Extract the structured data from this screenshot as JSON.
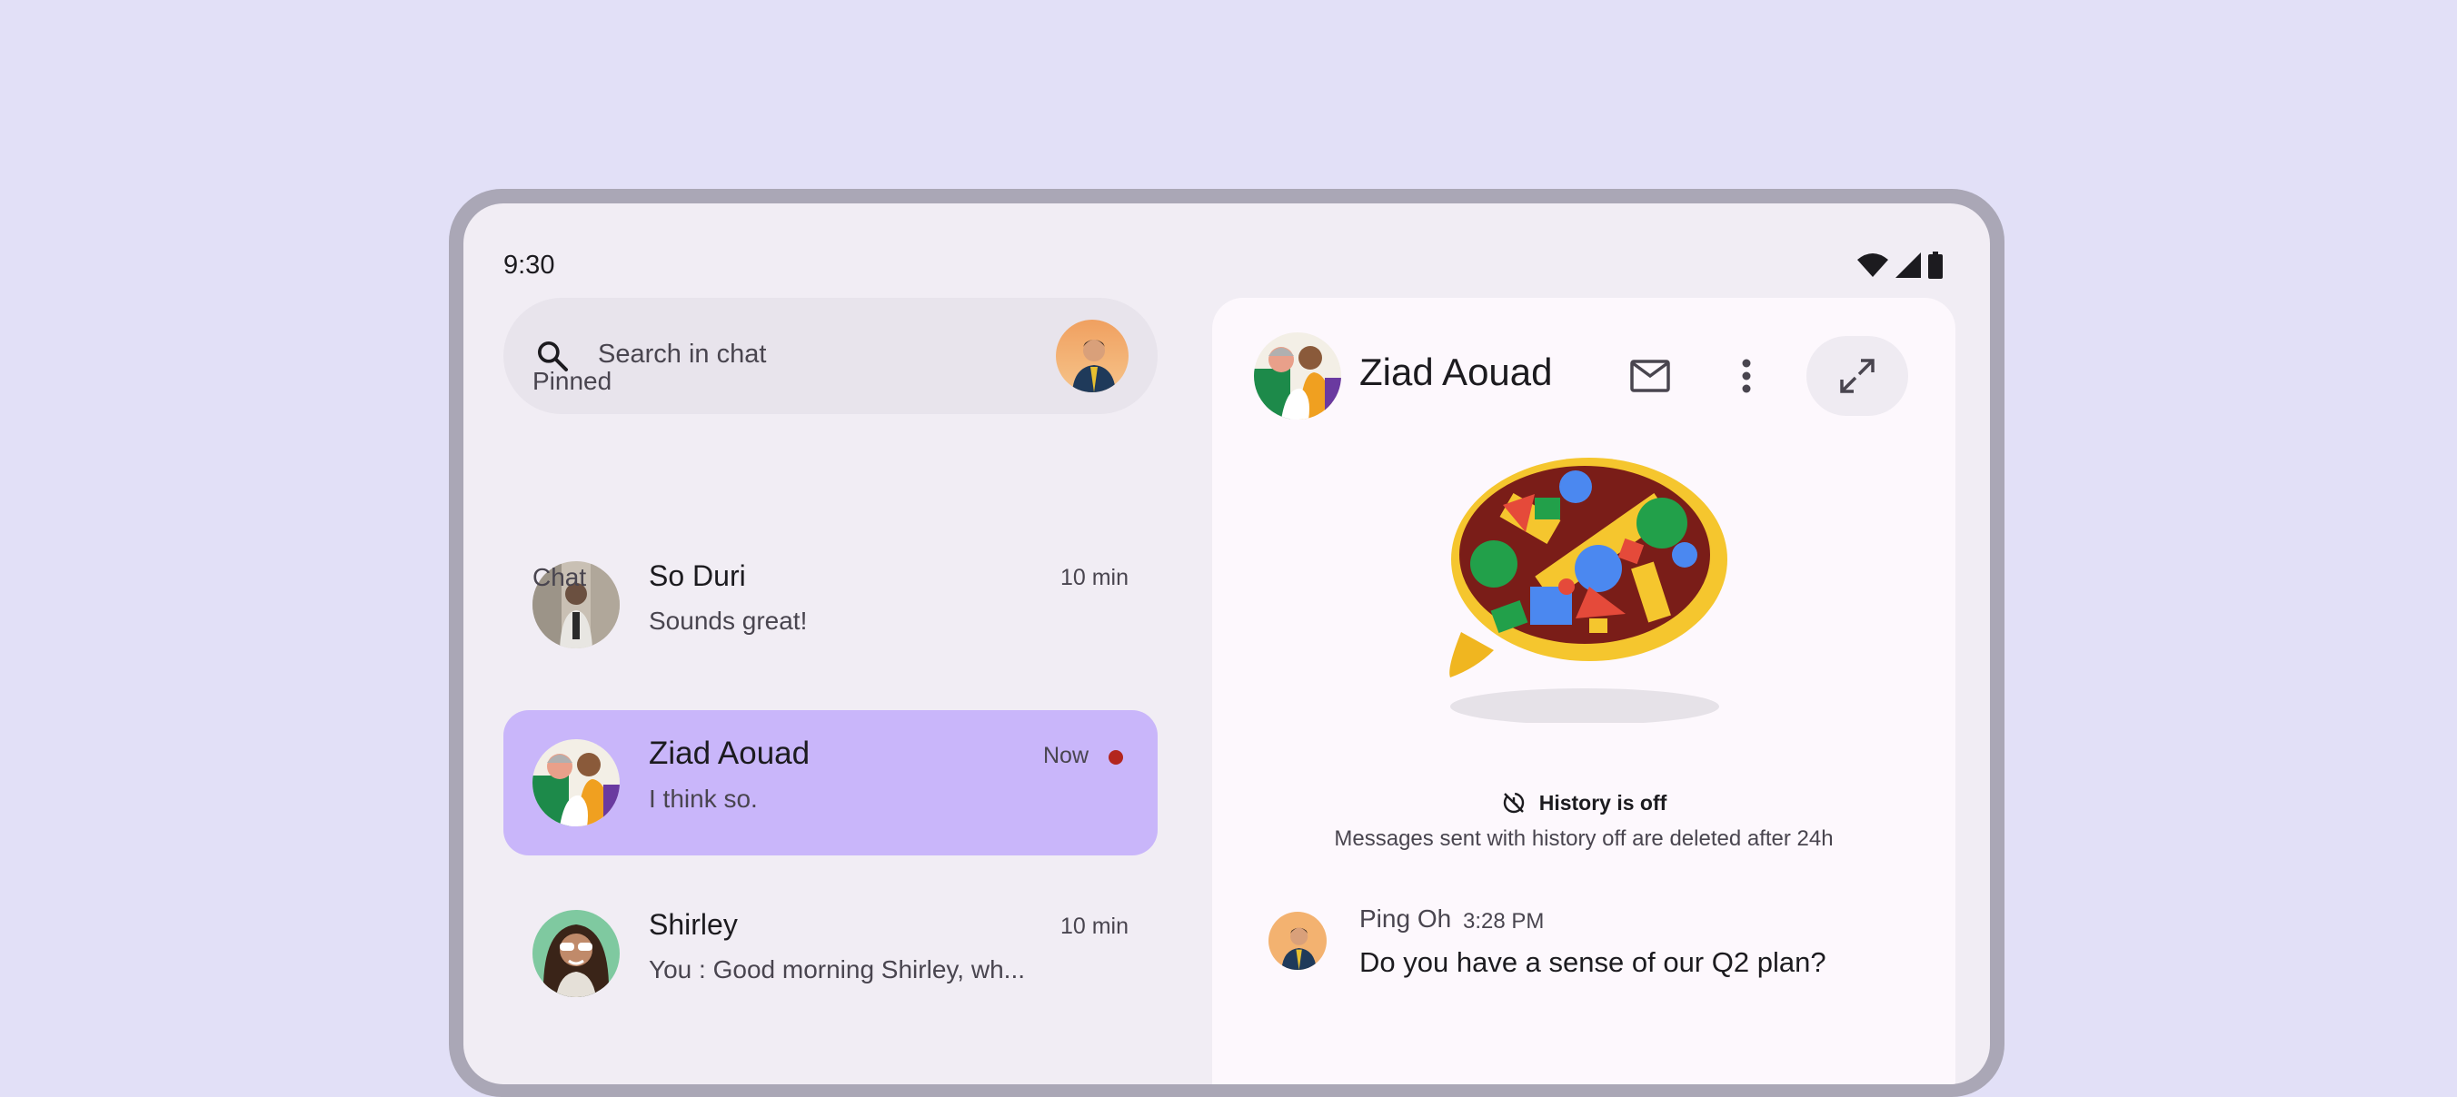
{
  "status_bar": {
    "time": "9:30"
  },
  "search": {
    "placeholder": "Search in chat"
  },
  "sections": {
    "pinned": "Pinned",
    "chat": "Chat"
  },
  "conversations": [
    {
      "name": "So Duri",
      "preview": "Sounds great!",
      "time": "10 min",
      "selected": false,
      "unread": false
    },
    {
      "name": "Ziad Aouad",
      "preview": "I think so.",
      "time": "Now",
      "selected": true,
      "unread": true
    },
    {
      "name": "Shirley",
      "preview": "You : Good morning Shirley, wh...",
      "time": "10 min",
      "selected": false,
      "unread": false
    }
  ],
  "detail": {
    "name": "Ziad Aouad",
    "history_title": "History is off",
    "history_note": "Messages sent with history off are deleted after 24h",
    "message": {
      "sender": "Ping Oh",
      "time": "3:28 PM",
      "text": "Do you have a sense of our Q2 plan?"
    }
  },
  "colors": {
    "background": "#e2e0f7",
    "screen": "#f1edf4",
    "selected_row": "#c9b6fa",
    "unread_dot": "#b3261e",
    "panel": "#fdf8fd"
  },
  "icons": [
    "wifi-icon",
    "signal-icon",
    "battery-icon",
    "search-icon",
    "mail-icon",
    "more-vert-icon",
    "open-in-full-icon",
    "history-off-icon"
  ]
}
